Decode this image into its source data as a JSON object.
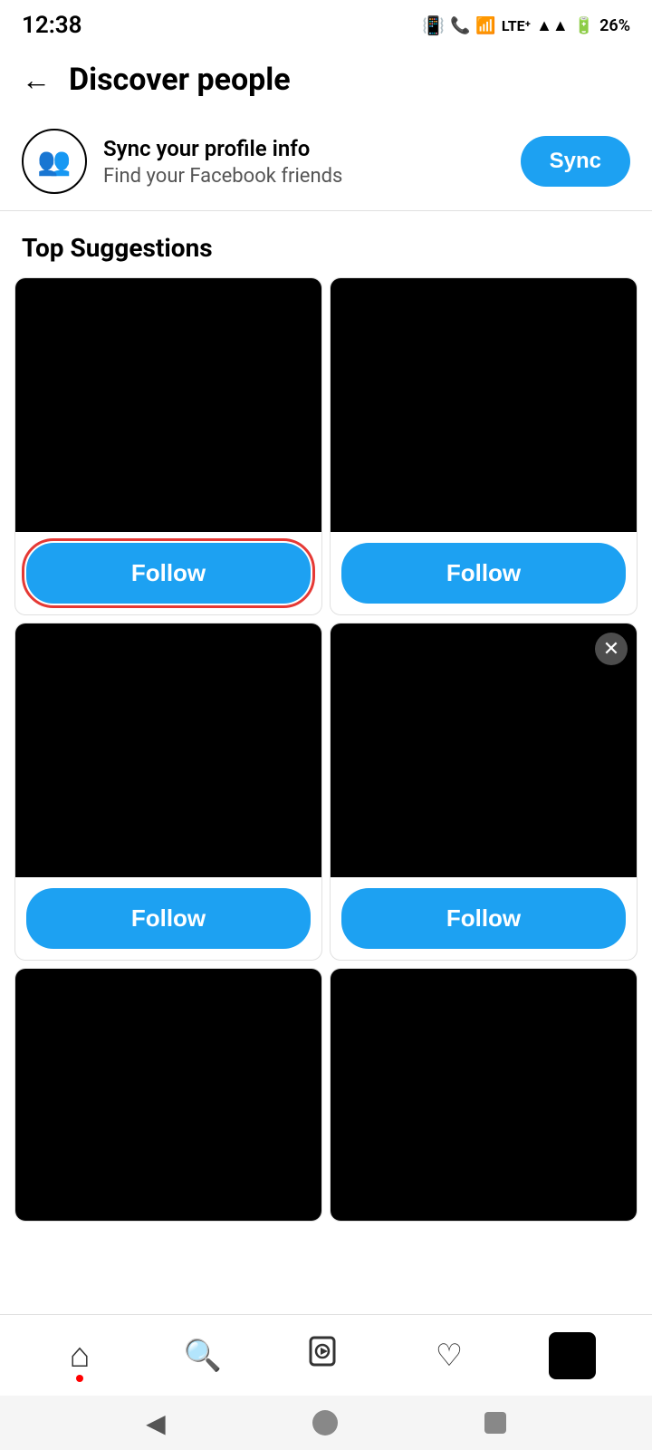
{
  "statusBar": {
    "time": "12:38",
    "battery": "26%",
    "signal": "LTE"
  },
  "header": {
    "backLabel": "←",
    "title": "Discover people"
  },
  "syncBanner": {
    "icon": "👥",
    "title": "Sync your profile info",
    "subtitle": "Find your Facebook friends",
    "buttonLabel": "Sync"
  },
  "topSuggestions": {
    "sectionTitle": "Top Suggestions",
    "cards": [
      {
        "id": 1,
        "followLabel": "Follow",
        "highlighted": true,
        "hasDismiss": false
      },
      {
        "id": 2,
        "followLabel": "Follow",
        "highlighted": false,
        "hasDismiss": false
      },
      {
        "id": 3,
        "followLabel": "Follow",
        "highlighted": false,
        "hasDismiss": false
      },
      {
        "id": 4,
        "followLabel": "Follow",
        "highlighted": false,
        "hasDismiss": true
      },
      {
        "id": 5,
        "followLabel": "",
        "highlighted": false,
        "hasDismiss": false
      },
      {
        "id": 6,
        "followLabel": "",
        "highlighted": false,
        "hasDismiss": false
      }
    ]
  },
  "bottomNav": {
    "items": [
      {
        "id": "home",
        "icon": "⌂",
        "hasDot": true
      },
      {
        "id": "search",
        "icon": "🔍",
        "hasDot": false
      },
      {
        "id": "video",
        "icon": "▶",
        "hasDot": false
      },
      {
        "id": "heart",
        "icon": "♡",
        "hasDot": false
      }
    ],
    "avatarLabel": ""
  },
  "systemBar": {
    "backIcon": "◀",
    "homeLabel": "",
    "squareLabel": ""
  }
}
